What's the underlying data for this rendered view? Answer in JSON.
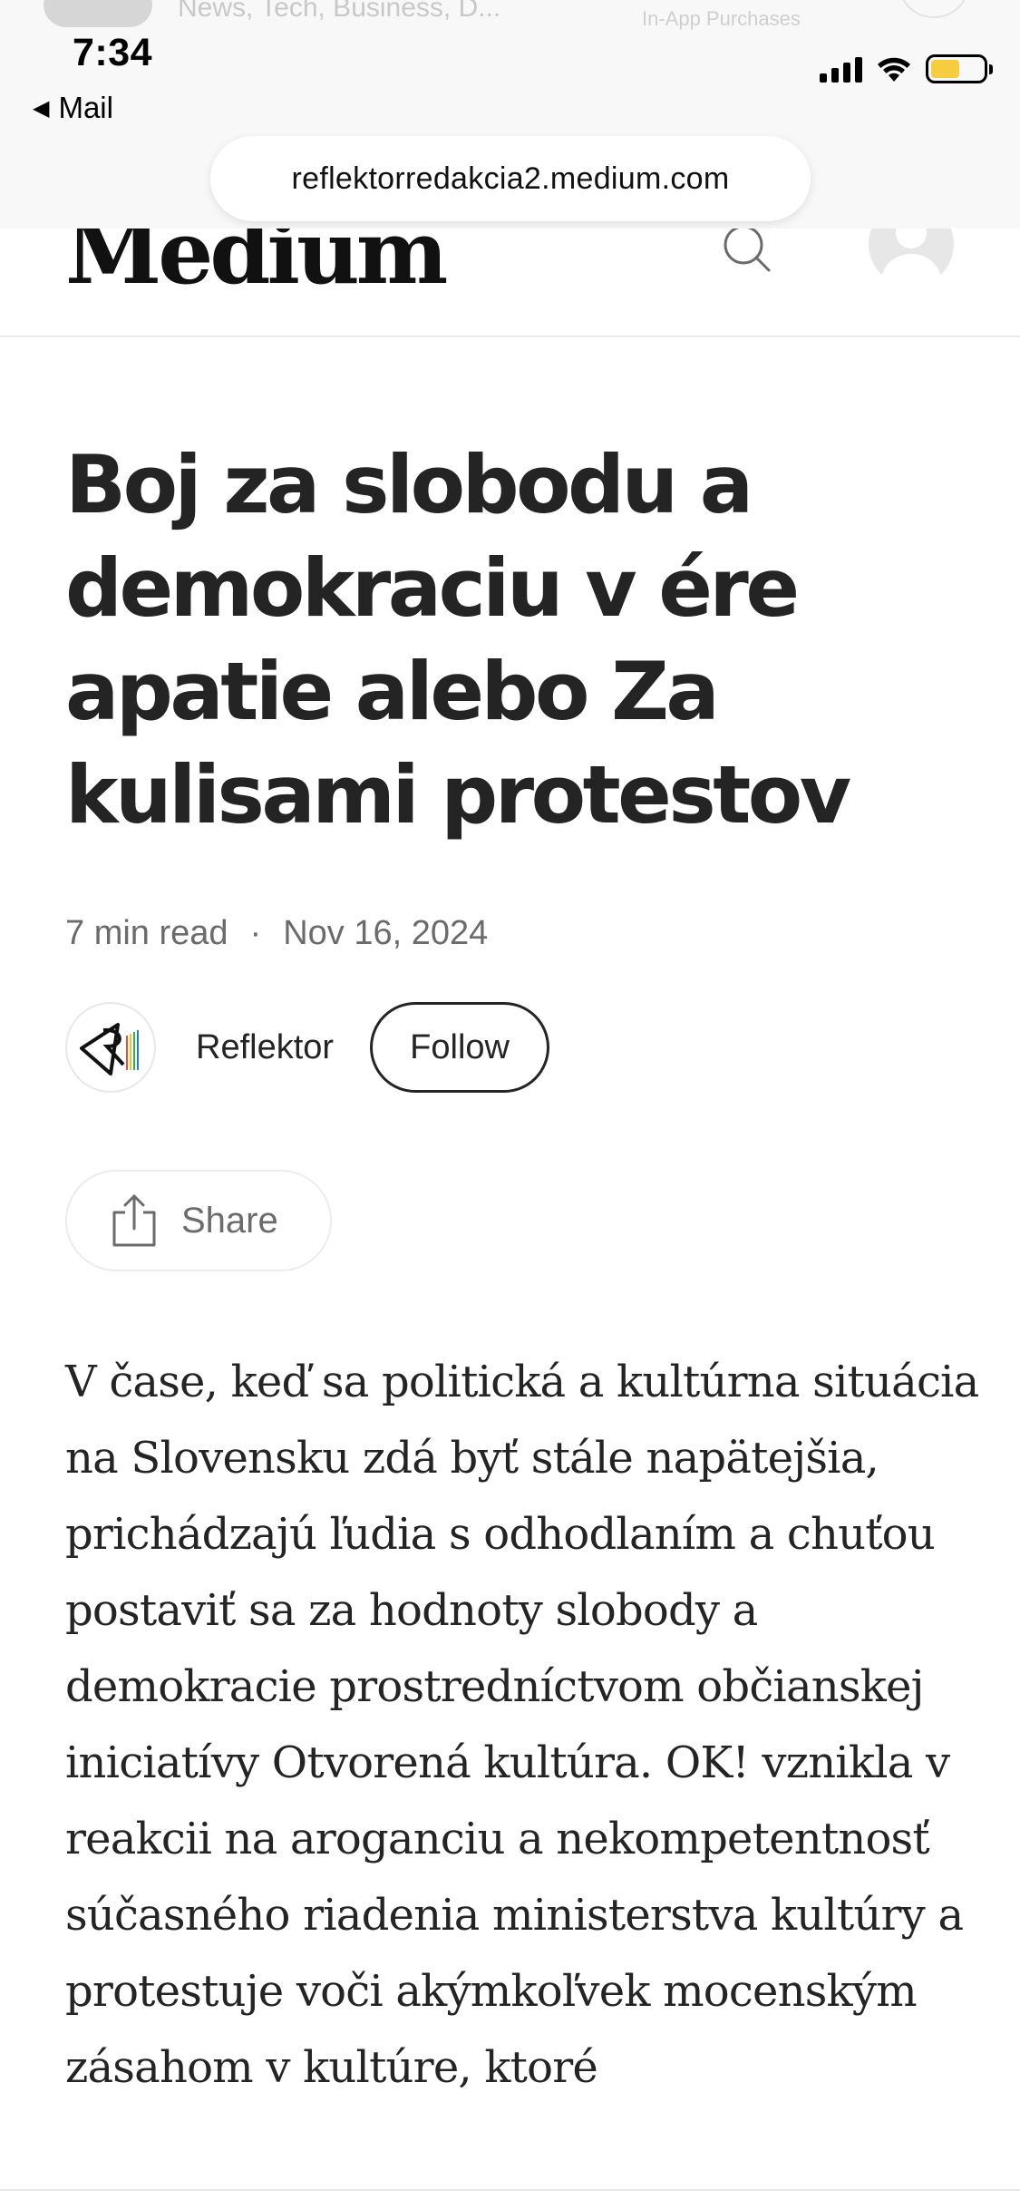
{
  "status_bar": {
    "time": "7:34",
    "back_app": "Mail",
    "battery_color": "#f5cd3f"
  },
  "background_peek": {
    "subtitle": "News, Tech, Business, D...",
    "badge": "In-App Purchases"
  },
  "browser": {
    "url": "reflektorredakcia2.medium.com"
  },
  "header": {
    "logo": "Medium",
    "search_icon": "search-icon",
    "avatar_icon": "user-avatar"
  },
  "article": {
    "title": "Boj za slobodu a demokraciu v ére apatie alebo Za kulisami protestov",
    "read_time": "7 min read",
    "separator": "·",
    "date": "Nov 16, 2024",
    "author": {
      "name": "Reflektor",
      "follow_label": "Follow"
    },
    "share_label": "Share",
    "body": "V čase, keď sa politická a kultúrna situácia na Slovensku zdá byť stále napätejšia, prichádzajú ľudia s odhodlaním a chuťou postaviť sa za hodnoty slobody a demokracie prostredníctvom občianskej iniciatívy Otvorená kultúra. OK! vznikla v reakcii na aroganciu a nekompetentnosť súčasného riadenia ministerstva kultúry a protestuje voči akýmkoľvek mocenským zásahom v kultúre, ktoré"
  }
}
